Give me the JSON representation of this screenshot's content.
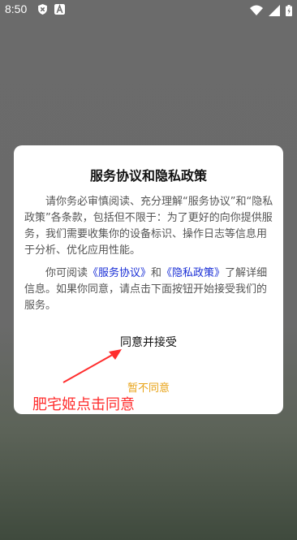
{
  "status_bar": {
    "time": "8:50",
    "icons": [
      "shield-icon",
      "a-badge-icon",
      "wifi-icon",
      "signal-icon",
      "battery-icon"
    ]
  },
  "dialog": {
    "title": "服务协议和隐私政策",
    "para1": "请你务必审慎阅读、充分理解“服务协议”和“隐私政策”各条款，包括但不限于：为了更好的向你提供服务，我们需要收集你的设备标识、操作日志等信息用于分析、优化应用性能。",
    "para2_prefix": "你可阅读",
    "link_service": "《服务协议》",
    "para2_and": "和",
    "link_privacy": "《隐私政策》",
    "para2_suffix": "了解详细信息。如果你同意，请点击下面按钮开始接受我们的服务。",
    "accept_label": "同意并接受",
    "decline_label": "暂不同意"
  },
  "annotation": {
    "text": "肥宅姬点击同意",
    "color": "#ff2d2d"
  },
  "colors": {
    "link": "#1a2fd6",
    "decline": "#e8a317"
  }
}
